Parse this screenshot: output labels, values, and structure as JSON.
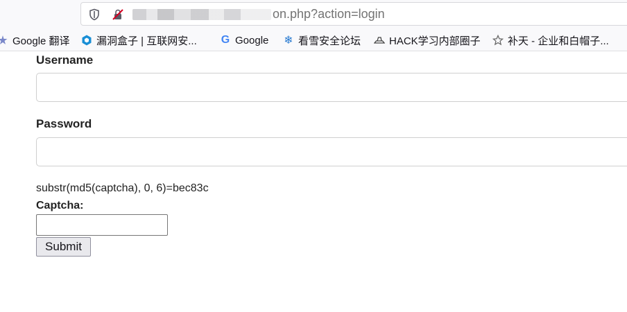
{
  "browser": {
    "url_suffix": "on.php?action=login",
    "bookmarks": [
      {
        "label": "Google 翻译",
        "icon": "google-translate-icon"
      },
      {
        "label": "漏洞盒子 | 互联网安...",
        "icon": "hexagon-icon"
      },
      {
        "label": "Google",
        "icon": "google-g-icon"
      },
      {
        "label": "看雪安全论坛",
        "icon": "snowflake-icon"
      },
      {
        "label": "HACK学习内部圈子",
        "icon": "boat-icon"
      },
      {
        "label": "补天 - 企业和白帽子...",
        "icon": "star-icon"
      }
    ]
  },
  "form": {
    "username_label": "Username",
    "username_value": "",
    "password_label": "Password",
    "password_value": "",
    "captcha_hint": "substr(md5(captcha), 0, 6)=bec83c",
    "captcha_label": "Captcha:",
    "captcha_value": "",
    "submit_label": "Submit"
  },
  "colors": {
    "accent_shield": "#5b5b66",
    "google_blue": "#4285f4",
    "hex_blue": "#1a8fd6",
    "snow_blue": "#2a7bd1"
  }
}
